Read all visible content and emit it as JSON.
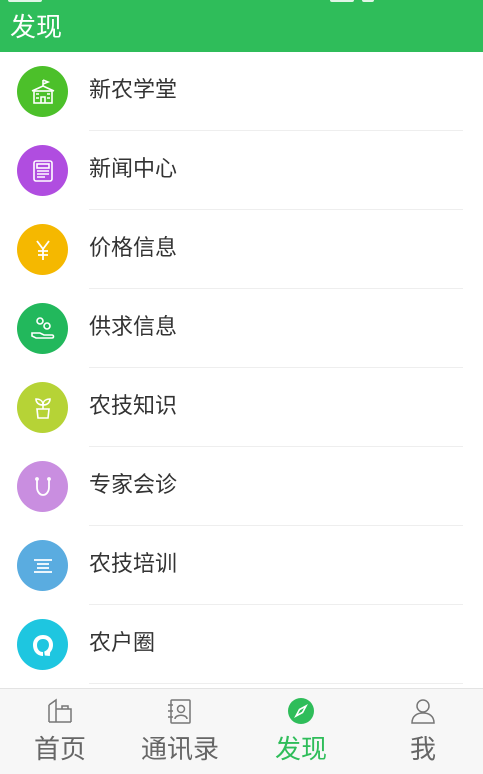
{
  "header": {
    "title": "发现"
  },
  "list": {
    "items": [
      {
        "label": "新农学堂",
        "icon": "school-icon",
        "color": "#4cc02a"
      },
      {
        "label": "新闻中心",
        "icon": "newspaper-icon",
        "color": "#b04de0"
      },
      {
        "label": "价格信息",
        "icon": "yen-icon",
        "color": "#f5b800"
      },
      {
        "label": "供求信息",
        "icon": "hand-coins-icon",
        "color": "#22b85c"
      },
      {
        "label": "农技知识",
        "icon": "sprout-pot-icon",
        "color": "#b6d336"
      },
      {
        "label": "专家会诊",
        "icon": "stethoscope-icon",
        "color": "#c98ee0"
      },
      {
        "label": "农技培训",
        "icon": "lines-icon",
        "color": "#5aace0"
      },
      {
        "label": "农户圈",
        "icon": "chat-ring-icon",
        "color": "#1ec6e0"
      }
    ]
  },
  "tabbar": {
    "tabs": [
      {
        "label": "首页",
        "icon": "home-icon",
        "active": false
      },
      {
        "label": "通讯录",
        "icon": "contacts-icon",
        "active": false
      },
      {
        "label": "发现",
        "icon": "compass-icon",
        "active": true
      },
      {
        "label": "我",
        "icon": "person-icon",
        "active": false
      }
    ],
    "active_color": "#2fbd5a",
    "inactive_color": "#666666"
  }
}
